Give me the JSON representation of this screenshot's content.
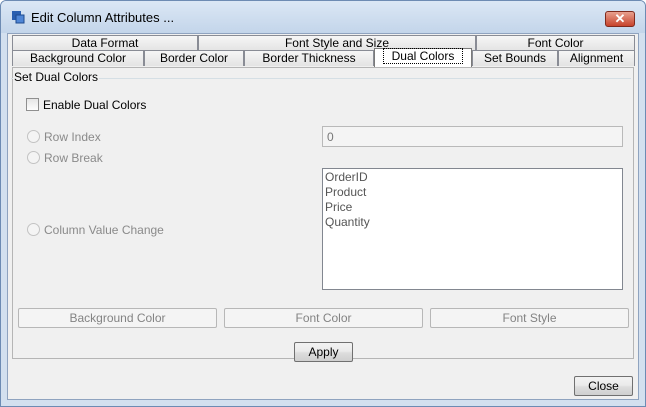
{
  "window": {
    "title": "Edit Column Attributes ...",
    "close_glyph": "✕"
  },
  "tabs_top": [
    {
      "label": "Data Format"
    },
    {
      "label": "Font Style and Size"
    },
    {
      "label": "Font Color"
    }
  ],
  "tabs_bottom": [
    {
      "label": "Background Color"
    },
    {
      "label": "Border Color"
    },
    {
      "label": "Border Thickness"
    },
    {
      "label": "Dual Colors",
      "active": true
    },
    {
      "label": "Set Bounds"
    },
    {
      "label": "Alignment"
    }
  ],
  "group": {
    "title": "Set Dual Colors",
    "enable_label": "Enable Dual Colors",
    "enable_checked": false,
    "options": [
      {
        "label": "Row Index"
      },
      {
        "label": "Row Break"
      },
      {
        "label": "Column Value Change"
      }
    ],
    "row_index_value": "0",
    "columns": [
      "OrderID",
      "Product",
      "Price",
      "Quantity"
    ],
    "buttons": [
      "Background Color",
      "Font Color",
      "Font Style"
    ]
  },
  "apply_label": "Apply",
  "close_label": "Close",
  "colors": {
    "titlebar": "#c3d5ea",
    "close_button": "#c7432b",
    "client": "#f0f0f0"
  }
}
